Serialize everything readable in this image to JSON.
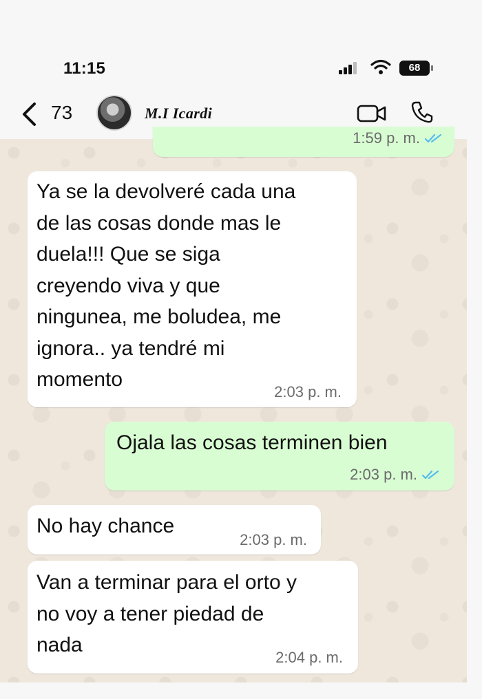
{
  "status_bar": {
    "time": "11:15",
    "battery": "68"
  },
  "header": {
    "back_count": "73",
    "contact_name": "M.I Icardi"
  },
  "icons": {
    "back": "chevron-left-icon",
    "video": "video-camera-icon",
    "call": "phone-icon",
    "read": "double-check-icon"
  },
  "colors": {
    "incoming_bubble": "#ffffff",
    "outgoing_bubble": "#d9fdd3",
    "read_ticks": "#53bdeb",
    "chat_background": "#efe7dc"
  },
  "messages": [
    {
      "direction": "outgoing",
      "text": "",
      "time": "1:59 p. m.",
      "status": "read"
    },
    {
      "direction": "incoming",
      "text": "Ya se la devolveré cada una\nde las cosas donde mas le\nduela!!! Que se siga\ncreyendo viva y que\nningunea, me boludea, me\nignora.. ya tendré mi\nmomento",
      "time": "2:03 p. m."
    },
    {
      "direction": "outgoing",
      "text": "Ojala las cosas terminen bien",
      "time": "2:03 p. m.",
      "status": "read"
    },
    {
      "direction": "incoming",
      "text": "No hay chance",
      "time": "2:03 p. m."
    },
    {
      "direction": "incoming",
      "text": "Van a terminar para el orto y\nno voy a tener piedad de\nnada",
      "time": "2:04 p. m."
    }
  ]
}
